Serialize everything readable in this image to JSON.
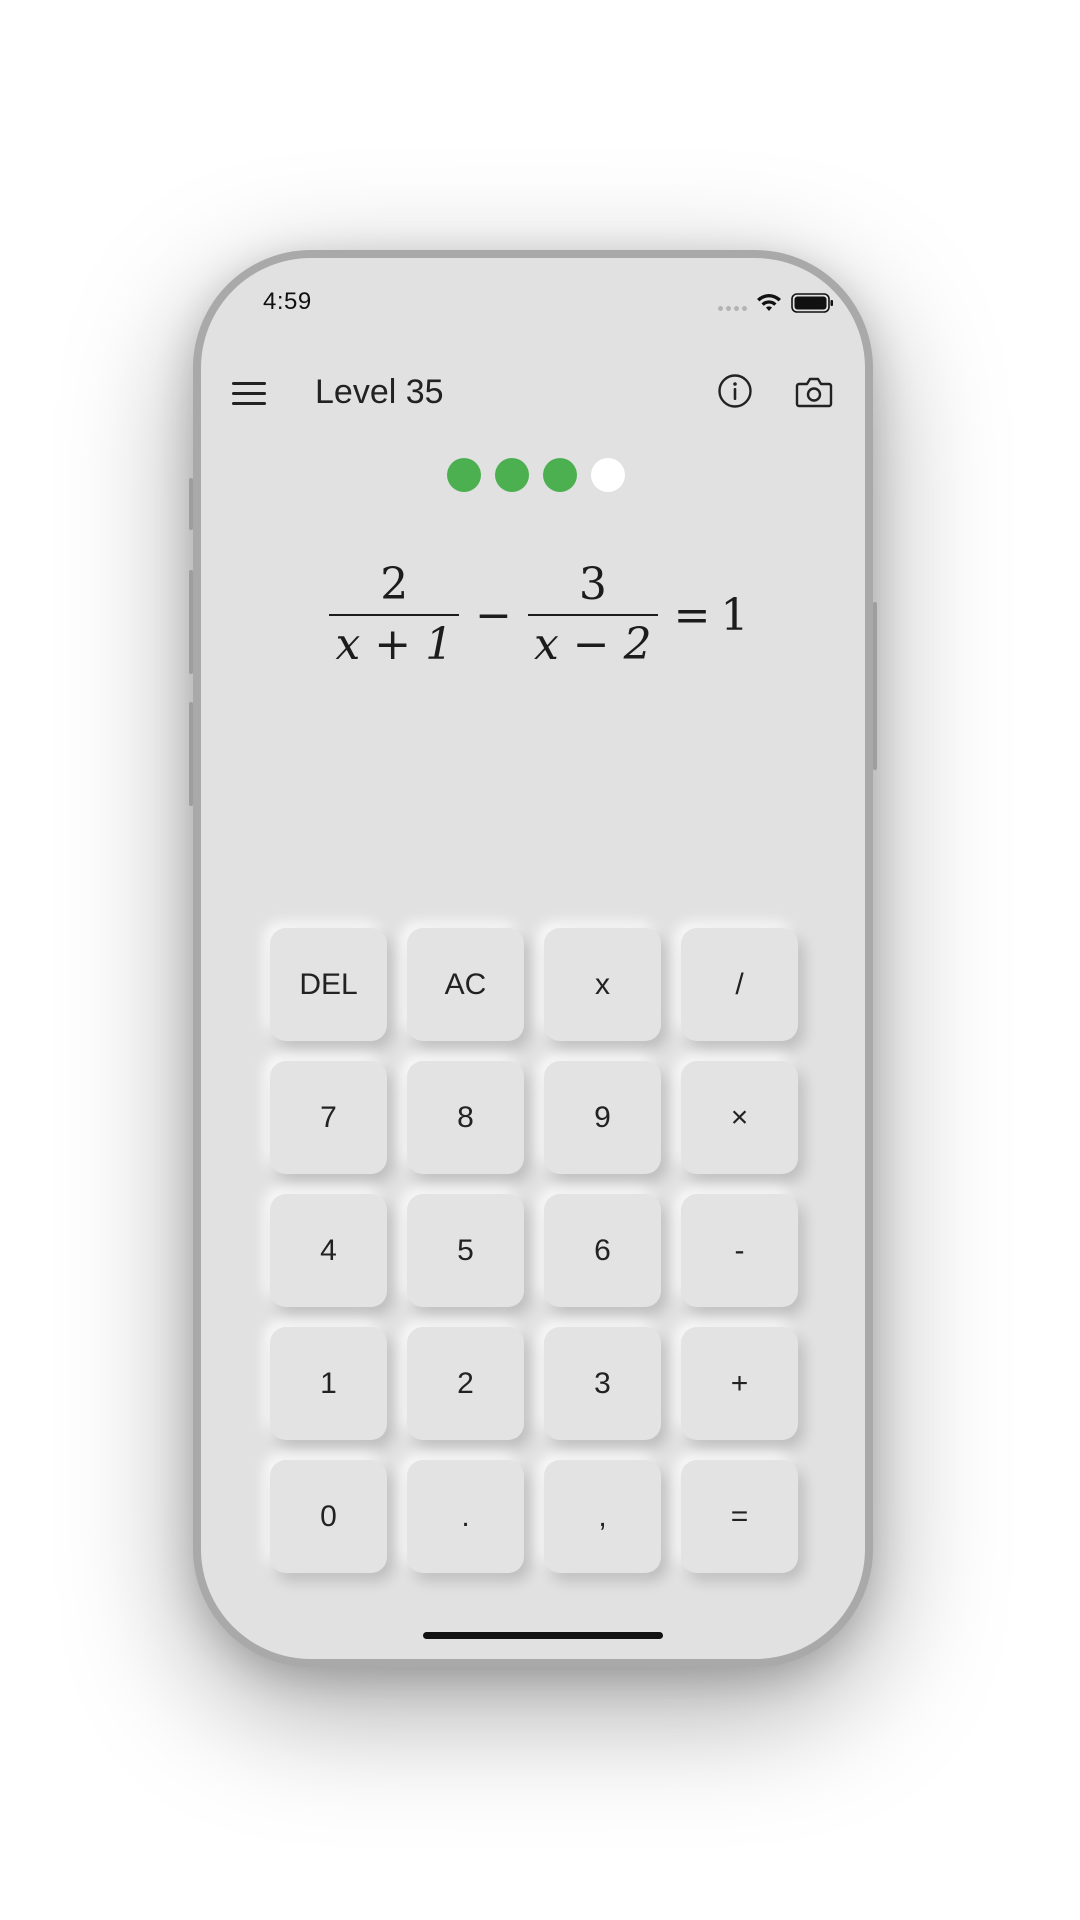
{
  "status_bar": {
    "time": "4:59"
  },
  "header": {
    "title": "Level 35"
  },
  "progress": {
    "completed": 3,
    "total": 4,
    "completed_color": "#4caf50",
    "remaining_color": "#ffffff"
  },
  "equation": {
    "term1_numerator": "2",
    "term1_denominator": "x + 1",
    "operator": "−",
    "term2_numerator": "3",
    "term2_denominator": "x − 2",
    "equals": "=",
    "rhs": "1"
  },
  "keypad": {
    "keys": [
      {
        "label": "DEL",
        "name": "delete-key"
      },
      {
        "label": "AC",
        "name": "all-clear-key"
      },
      {
        "label": "x",
        "name": "variable-x-key"
      },
      {
        "label": "/",
        "name": "divide-key"
      },
      {
        "label": "7",
        "name": "digit-7-key"
      },
      {
        "label": "8",
        "name": "digit-8-key"
      },
      {
        "label": "9",
        "name": "digit-9-key"
      },
      {
        "label": "×",
        "name": "multiply-key"
      },
      {
        "label": "4",
        "name": "digit-4-key"
      },
      {
        "label": "5",
        "name": "digit-5-key"
      },
      {
        "label": "6",
        "name": "digit-6-key"
      },
      {
        "label": "-",
        "name": "minus-key"
      },
      {
        "label": "1",
        "name": "digit-1-key"
      },
      {
        "label": "2",
        "name": "digit-2-key"
      },
      {
        "label": "3",
        "name": "digit-3-key"
      },
      {
        "label": "+",
        "name": "plus-key"
      },
      {
        "label": "0",
        "name": "digit-0-key"
      },
      {
        "label": ".",
        "name": "decimal-point-key"
      },
      {
        "label": ",",
        "name": "comma-key"
      },
      {
        "label": "=",
        "name": "equals-key"
      }
    ]
  },
  "icons": {
    "menu": "hamburger-menu-icon",
    "info": "info-icon",
    "camera": "camera-icon",
    "wifi": "wifi-icon",
    "battery": "battery-icon",
    "signal": "cellular-signal-icon"
  }
}
